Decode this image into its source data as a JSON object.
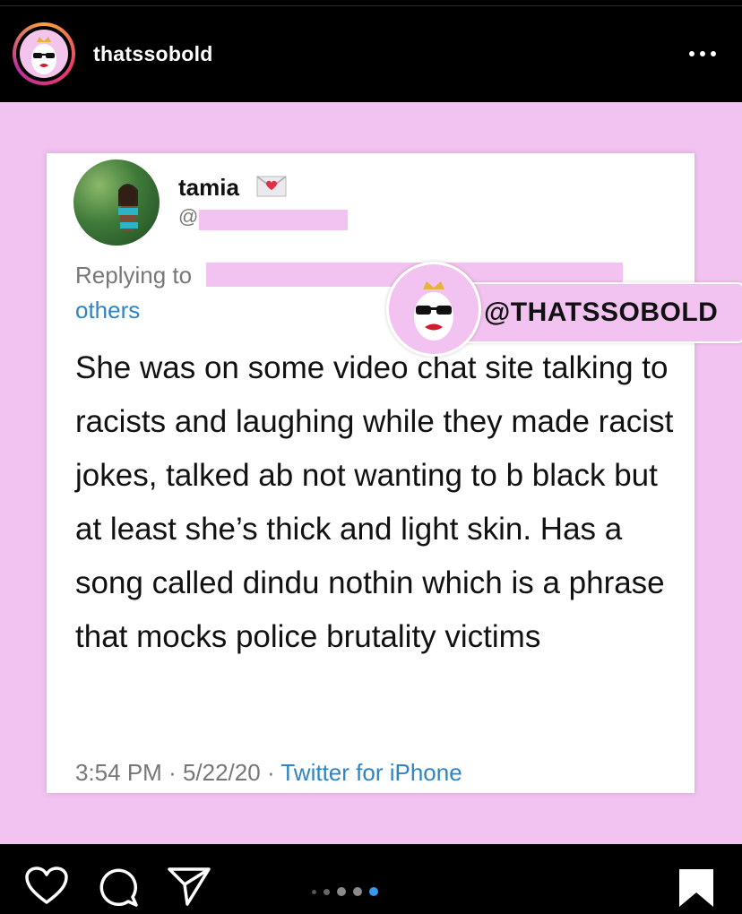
{
  "header": {
    "username": "thatssobold",
    "avatar_icon": "sunglasses-egg-icon",
    "more_icon": "more-horizontal-icon"
  },
  "tweet": {
    "name": "tamia",
    "name_emoji": "heart-letter-icon",
    "handle": "@",
    "replying_to": "Replying to",
    "others": "others",
    "body": "She was on some video chat site talking to racists and laughing while they made racist jokes, talked ab not wanting to b black but at least she’s thick and light skin. Has a song called dindu nothin which is a phrase that mocks police brutality victims",
    "time": "3:54 PM",
    "date": "5/22/20",
    "source": "Twitter for iPhone"
  },
  "watermark": {
    "text": "@THATSSOBOLD"
  },
  "actions": {
    "like_icon": "heart-icon",
    "comment_icon": "comment-icon",
    "share_icon": "send-icon",
    "save_icon": "bookmark-icon",
    "carousel_total": 5,
    "carousel_active": 5
  },
  "colors": {
    "background_pink": "#f2c3f0",
    "link_blue": "#2f84c4",
    "carousel_active": "#3897f0"
  }
}
